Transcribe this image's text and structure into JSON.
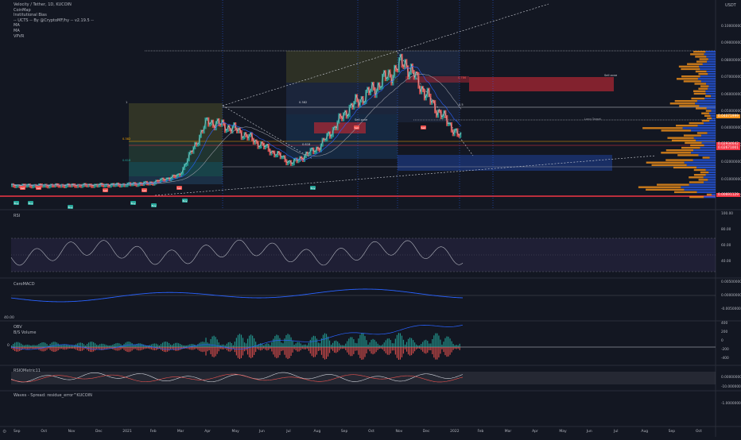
{
  "legend": {
    "symbol": "Velocity / Tether, 1D, KUCOIN",
    "lines": [
      "CoinMap",
      "Institutional Bias",
      "-- UCTS -- By @CryptoMF/hy -- v2.19.5 --",
      "MA",
      "MA",
      "VPVR"
    ]
  },
  "currency": "USDT",
  "price_axis": {
    "ticks": [
      "0.10000000",
      "0.09000000",
      "0.08000000",
      "0.07000000",
      "0.06000000",
      "0.05000000",
      "0.04000000",
      "0.03000000",
      "0.02000000",
      "0.01000000",
      "0.00000000"
    ],
    "badges": [
      {
        "text": "0.04071999",
        "color": "#f7931a"
      },
      {
        "text": "0.02934642",
        "color": "#f23645"
      },
      {
        "text": "0.02671001",
        "color": "#f23645"
      },
      {
        "text": "0.00691129",
        "color": "#f23645"
      }
    ]
  },
  "date_axis": [
    "Sep",
    "Oct",
    "Nov",
    "Dec",
    "2021",
    "Feb",
    "Mar",
    "Apr",
    "May",
    "Jun",
    "Jul",
    "Aug",
    "Sep",
    "Oct",
    "Nov",
    "Dec",
    "2022",
    "Feb",
    "Mar",
    "Apr",
    "May",
    "Jun",
    "Jul",
    "Aug",
    "Sep",
    "Oct"
  ],
  "annotations": {
    "sell_zone_1": "Sell zone",
    "sell_zone_2": "Sell zone",
    "sell_zone_3": "Sell zone",
    "fib_0382": "0.382",
    "fib_0618": "0.618",
    "fib_1": "1",
    "fib_05": "0.5",
    "fib_0786": "0.786",
    "fib_0382b": "0.382",
    "fib_0618b": "0.618",
    "long_target": "Long Target",
    "buy": "Buy",
    "sell": "Sell"
  },
  "panes": {
    "rsi": {
      "label": "RSI",
      "ticks": [
        "100.00",
        "80.00",
        "60.00",
        "40.00"
      ]
    },
    "macd": {
      "label": "CeroMACD",
      "ticks": [
        "0.00500000",
        "0.00000000",
        "-0.00500000"
      ]
    },
    "obv": {
      "label": "OBV",
      "label2": "B/S Volume",
      "ticks": [
        "400",
        "200",
        "0",
        "-200",
        "-400"
      ],
      "left_ticks": [
        "40.00",
        "0"
      ]
    },
    "wave": {
      "label": "RSIOMetric11",
      "ticks": [
        "0.000000000",
        "-10.000000000"
      ]
    },
    "spread": {
      "label": "Waves - Spread: residue_error^KUCOIN",
      "ticks": [
        "-1.00000000"
      ]
    }
  },
  "chart_data": {
    "type": "line",
    "title": "Velocity / Tether, 1D, KUCOIN",
    "x": [
      "Sep 2020",
      "Oct",
      "Nov",
      "Dec",
      "Jan 2021",
      "Feb",
      "Mar",
      "Apr",
      "May",
      "Jun",
      "Jul",
      "Aug",
      "Sep",
      "Oct",
      "Nov",
      "Dec",
      "Jan 2022"
    ],
    "series": [
      {
        "values": [
          0.007,
          0.007,
          0.0071,
          0.0072,
          0.0075,
          0.0085,
          0.013,
          0.045,
          0.04,
          0.03,
          0.02,
          0.03,
          0.052,
          0.065,
          0.08,
          0.055,
          0.035
        ]
      }
    ],
    "ylim": [
      0.0,
      0.1
    ],
    "grid": false
  }
}
